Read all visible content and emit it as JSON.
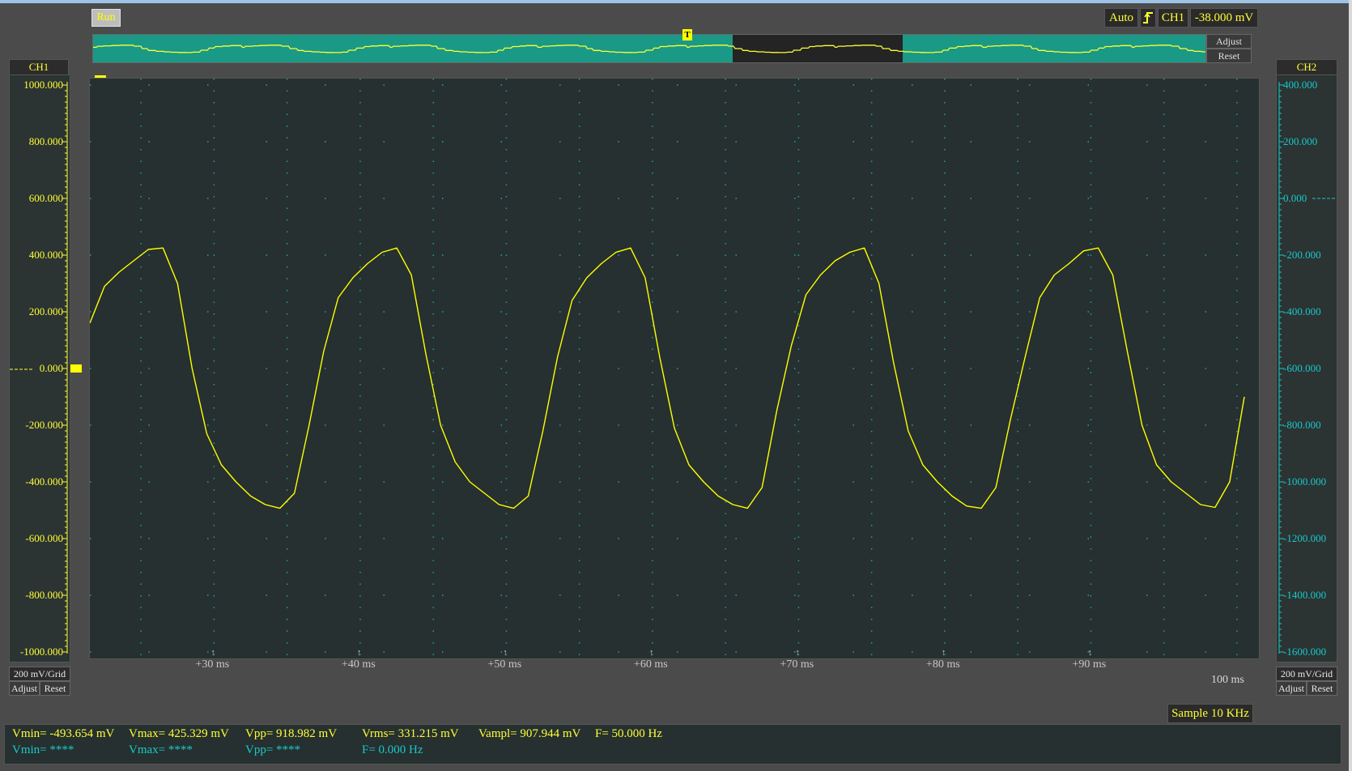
{
  "toolbar": {
    "run_label": "Run",
    "trigger_mode": "Auto",
    "trigger_edge_icon": "rising-edge-icon",
    "trigger_source": "CH1",
    "trigger_level": "-38.000 mV"
  },
  "overview": {
    "trigger_marker_label": "T",
    "adjust_label": "Adjust",
    "reset_label": "Reset"
  },
  "colors": {
    "ch1": "#ffff00",
    "ch2": "#19c9c9",
    "grid_bg": "#263030",
    "overview_window": "#1a9a86"
  },
  "ch1": {
    "label": "CH1",
    "ticks": [
      "1000.000",
      "800.000",
      "600.000",
      "400.000",
      "200.000",
      "0.000",
      "-200.000",
      "-400.000",
      "-600.000",
      "-800.000",
      "-1000.000"
    ],
    "scale": "200 mV/Grid",
    "adjust_label": "Adjust",
    "reset_label": "Reset"
  },
  "ch2": {
    "label": "CH2",
    "ticks": [
      "400.000",
      "200.000",
      "0.000",
      "-200.000",
      "-400.000",
      "-600.000",
      "-800.000",
      "-1000.000",
      "-1200.000",
      "-1400.000",
      "-1600.000"
    ],
    "scale": "200 mV/Grid",
    "adjust_label": "Adjust",
    "reset_label": "Reset"
  },
  "time_axis": {
    "ticks": [
      "+30 ms",
      "+40 ms",
      "+50 ms",
      "+60 ms",
      "+70 ms",
      "+80 ms",
      "+90 ms"
    ],
    "end_label": "100 ms"
  },
  "sample_rate": "Sample 10 KHz",
  "measurements": {
    "ch1": {
      "vmin": "Vmin= -493.654 mV",
      "vmax": "Vmax= 425.329 mV",
      "vpp": "Vpp= 918.982 mV",
      "vrms": "Vrms= 331.215 mV",
      "vampl": "Vampl= 907.944 mV",
      "freq": "F= 50.000 Hz"
    },
    "ch2": {
      "vmin": "Vmin= ****",
      "vmax": "Vmax= ****",
      "vpp": "Vpp= ****",
      "freq": "F= 0.000 Hz"
    }
  },
  "chart_data": {
    "type": "line",
    "title": "",
    "xlabel": "",
    "ylabel": "",
    "xlim": [
      21.5,
      101.5
    ],
    "ylim": [
      -1000,
      1000
    ],
    "x_unit": "ms",
    "y_unit": "mV",
    "grid": true,
    "series": [
      {
        "name": "CH1",
        "x": [
          21.5,
          22.5,
          23.5,
          24.5,
          25.5,
          26.5,
          27.5,
          28.5,
          29.5,
          30.5,
          31.5,
          32.5,
          33.5,
          34.5,
          35.5,
          36.5,
          37.5,
          38.5,
          39.5,
          40.5,
          41.5,
          42.5,
          43.5,
          44.5,
          45.5,
          46.5,
          47.5,
          48.5,
          49.5,
          50.5,
          51.5,
          52.5,
          53.5,
          54.5,
          55.5,
          56.5,
          57.5,
          58.5,
          59.5,
          60.5,
          61.5,
          62.5,
          63.5,
          64.5,
          65.5,
          66.5,
          67.5,
          68.5,
          69.5,
          70.5,
          71.5,
          72.5,
          73.5,
          74.5,
          75.5,
          76.5,
          77.5,
          78.5,
          79.5,
          80.5,
          81.5,
          82.5,
          83.5,
          84.5,
          85.5,
          86.5,
          87.5,
          88.5,
          89.5,
          90.5,
          91.5,
          92.5,
          93.5,
          94.5,
          95.5,
          96.5,
          97.5,
          98.5,
          99.5,
          100.5
        ],
        "values": [
          160,
          290,
          340,
          380,
          420,
          425,
          300,
          0,
          -230,
          -340,
          -400,
          -450,
          -480,
          -493,
          -440,
          -200,
          60,
          250,
          320,
          370,
          410,
          425,
          330,
          50,
          -200,
          -330,
          -400,
          -440,
          -480,
          -493,
          -450,
          -220,
          40,
          240,
          320,
          370,
          410,
          425,
          320,
          40,
          -210,
          -340,
          -400,
          -450,
          -480,
          -493,
          -420,
          -150,
          80,
          260,
          330,
          380,
          410,
          425,
          300,
          20,
          -220,
          -340,
          -400,
          -450,
          -485,
          -493,
          -420,
          -180,
          40,
          250,
          330,
          370,
          415,
          425,
          330,
          60,
          -200,
          -340,
          -400,
          -440,
          -480,
          -490,
          -400,
          -100
        ]
      }
    ]
  }
}
